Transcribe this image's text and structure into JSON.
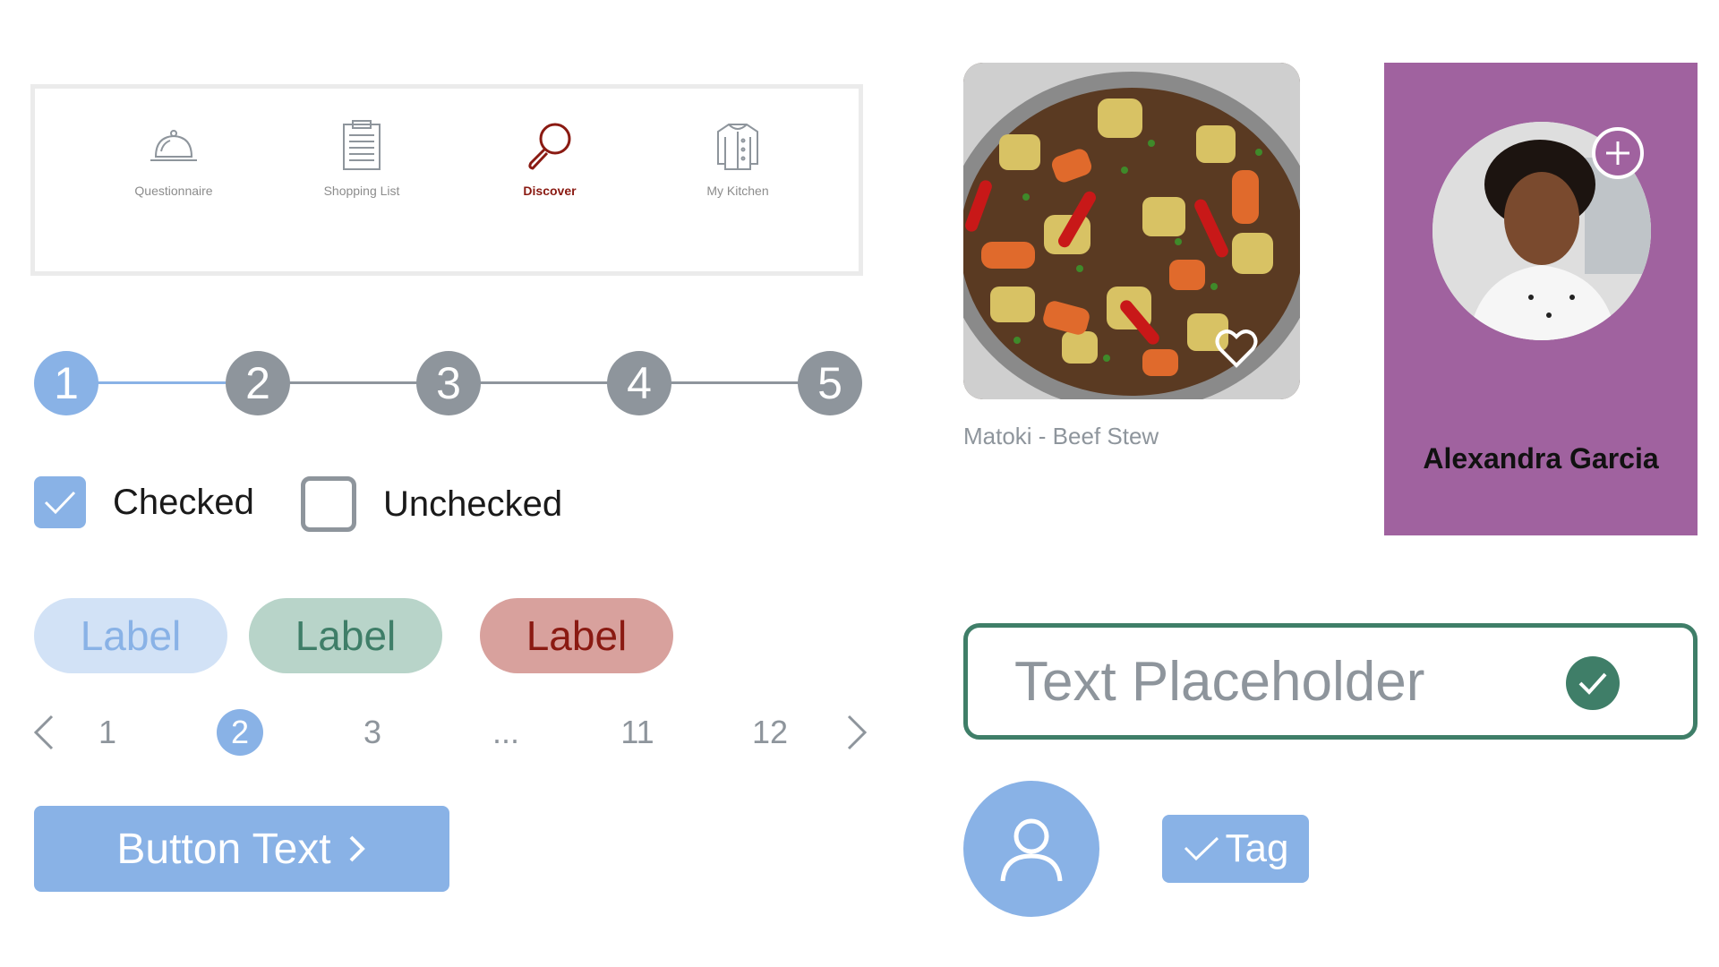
{
  "tabbar": {
    "tabs": [
      {
        "label": "Questionnaire",
        "icon": "cloche-icon",
        "active": false
      },
      {
        "label": "Shopping List",
        "icon": "clipboard-icon",
        "active": false
      },
      {
        "label": "Discover",
        "icon": "search-icon",
        "active": true
      },
      {
        "label": "My Kitchen",
        "icon": "chef-coat-icon",
        "active": false
      }
    ]
  },
  "stepper": {
    "steps": [
      "1",
      "2",
      "3",
      "4",
      "5"
    ],
    "current": 1
  },
  "checkboxes": {
    "checked_label": "Checked",
    "unchecked_label": "Unchecked"
  },
  "labels": {
    "blue": "Label",
    "green": "Label",
    "red": "Label"
  },
  "pagination": {
    "pages": [
      "1",
      "2",
      "3",
      "...",
      "11",
      "12"
    ],
    "current": "2"
  },
  "button": {
    "text": "Button Text"
  },
  "recipe": {
    "title": "Matoki - Beef Stew"
  },
  "profile": {
    "name": "Alexandra Garcia"
  },
  "textfield": {
    "placeholder": "Text Placeholder"
  },
  "tag": {
    "text": "Tag"
  },
  "colors": {
    "primary": "#89b2e6",
    "neutral": "#8e959c",
    "success": "#3f7e68",
    "danger": "#8a1a12",
    "profile_bg": "#a0629f"
  }
}
